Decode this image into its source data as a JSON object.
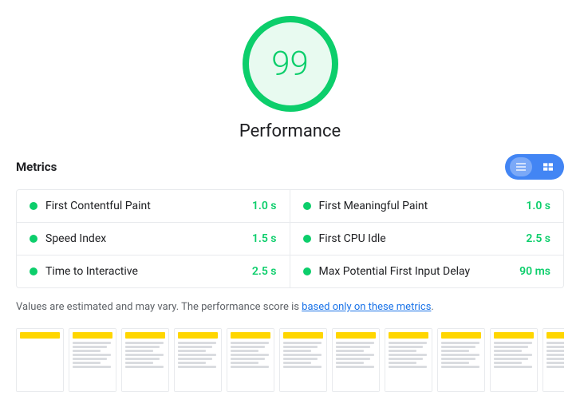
{
  "score": {
    "value": "99",
    "label": "Performance"
  },
  "metrics_header": {
    "title": "Metrics"
  },
  "toggle": {
    "btn1_label": "list-view",
    "btn2_label": "treemap-view"
  },
  "metrics": [
    {
      "name": "First Contentful Paint",
      "value": "1.0 s",
      "color": "#0cce6b"
    },
    {
      "name": "First Meaningful Paint",
      "value": "1.0 s",
      "color": "#0cce6b"
    },
    {
      "name": "Speed Index",
      "value": "1.5 s",
      "color": "#0cce6b"
    },
    {
      "name": "First CPU Idle",
      "value": "2.5 s",
      "color": "#0cce6b"
    },
    {
      "name": "Time to Interactive",
      "value": "2.5 s",
      "color": "#0cce6b"
    },
    {
      "name": "Max Potential First Input Delay",
      "value": "90 ms",
      "color": "#0cce6b"
    }
  ],
  "note": {
    "text_before": "Values are estimated and may vary. The performance score is ",
    "link_text": "based only on these metrics",
    "text_after": "."
  },
  "filmstrip": {
    "frames": [
      1,
      2,
      3,
      4,
      5,
      6,
      7,
      8,
      9,
      10,
      11
    ]
  }
}
